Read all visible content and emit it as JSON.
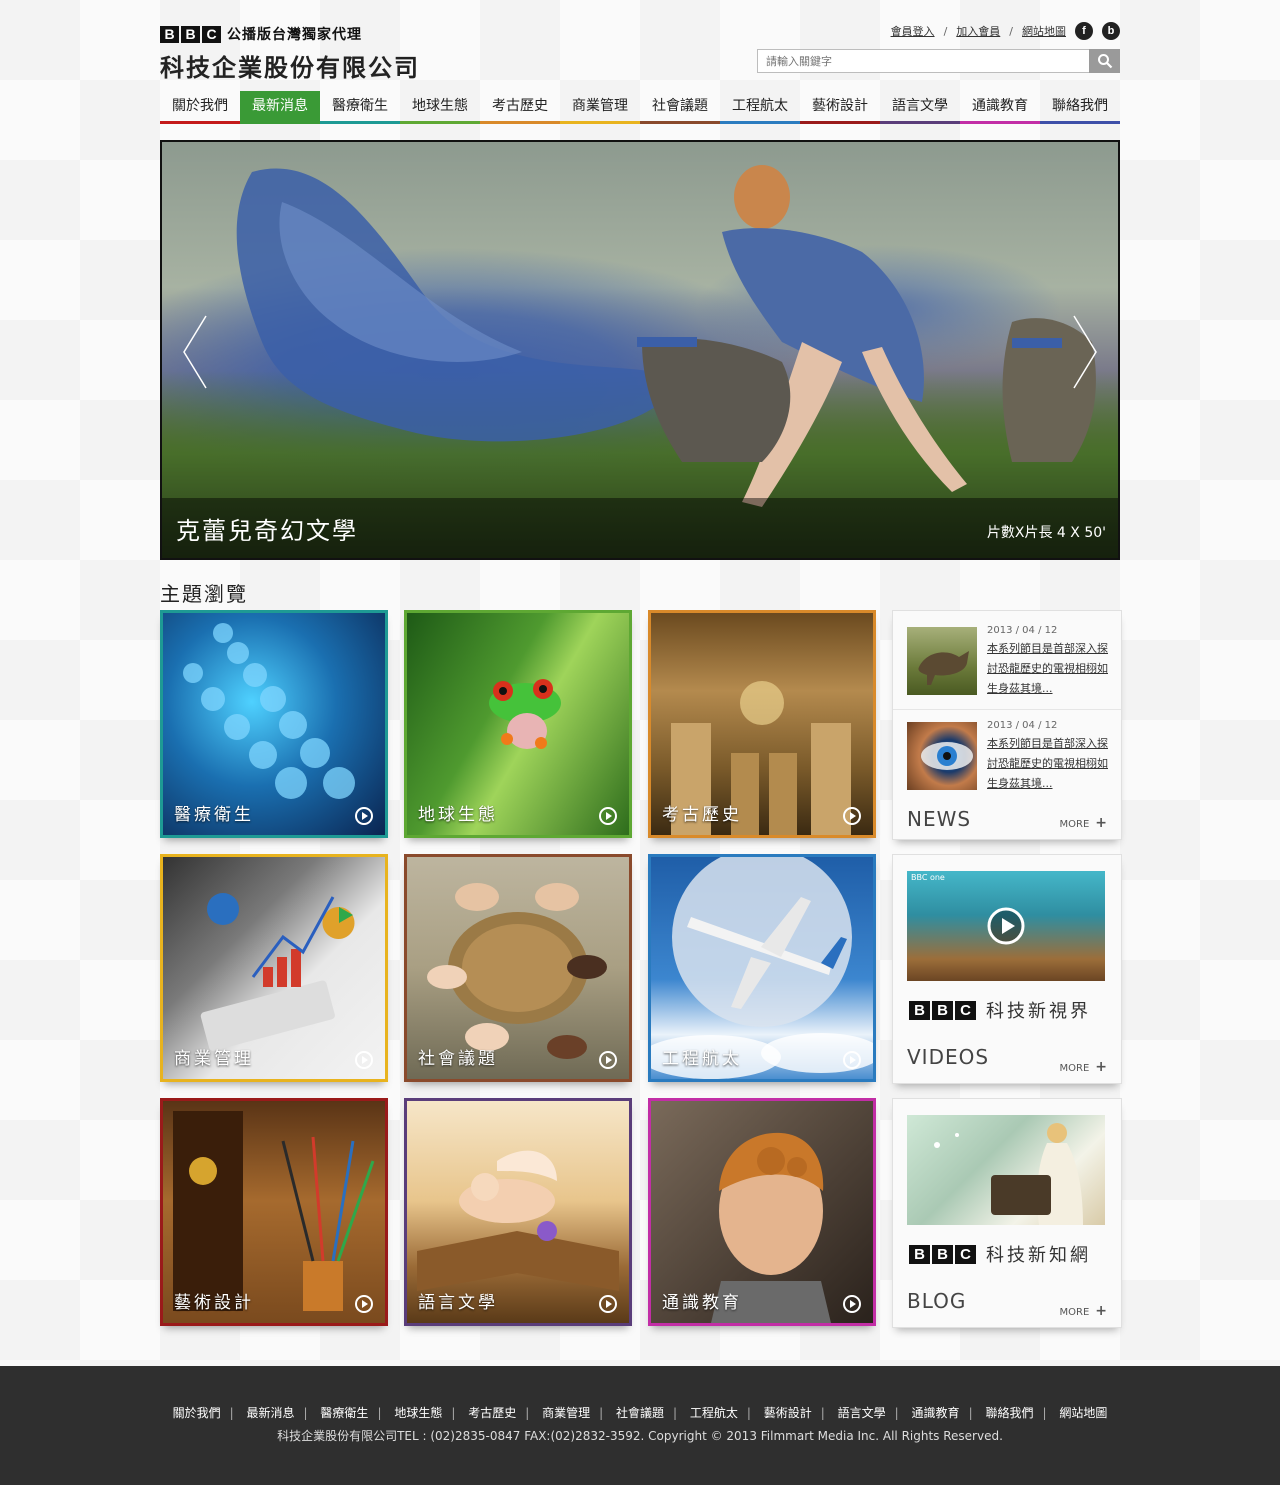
{
  "header": {
    "logo_bbc": [
      "B",
      "B",
      "C"
    ],
    "logo_sub": "公播版台灣獨家代理",
    "logo_main": "科技企業股份有限公司",
    "top_links": [
      "會員登入",
      "加入會員",
      "網站地圖"
    ],
    "social": [
      "facebook-icon",
      "blogger-icon"
    ],
    "search_placeholder": "請輸入關鍵字"
  },
  "nav": {
    "items": [
      {
        "label": "關於我們",
        "color": "#c41a1a"
      },
      {
        "label": "最新消息",
        "color": "#3a9a36"
      },
      {
        "label": "醫療衛生",
        "color": "#1e9a94"
      },
      {
        "label": "地球生態",
        "color": "#5ea833"
      },
      {
        "label": "考古歷史",
        "color": "#d98a2a"
      },
      {
        "label": "商業管理",
        "color": "#e8b31e"
      },
      {
        "label": "社會議題",
        "color": "#8a4a2c"
      },
      {
        "label": "工程航太",
        "color": "#2a7bbf"
      },
      {
        "label": "藝術設計",
        "color": "#9a1a1a"
      },
      {
        "label": "語言文學",
        "color": "#5a3d7a"
      },
      {
        "label": "通識教育",
        "color": "#c22ea6"
      },
      {
        "label": "聯絡我們",
        "color": "#3d4fa8"
      }
    ],
    "active": "最新消息"
  },
  "hero": {
    "title": "克蕾兒奇幻文學",
    "meta": "片數X片長 4 X 50'"
  },
  "section_title": "主題瀏覽",
  "tiles": [
    {
      "label": "醫療衛生",
      "color": "#1e9a94"
    },
    {
      "label": "地球生態",
      "color": "#5ea833"
    },
    {
      "label": "考古歷史",
      "color": "#d98a2a"
    },
    {
      "label": "商業管理",
      "color": "#e8b31e"
    },
    {
      "label": "社會議題",
      "color": "#8a4a2c"
    },
    {
      "label": "工程航太",
      "color": "#2a7bbf"
    },
    {
      "label": "藝術設計",
      "color": "#9a1a1a"
    },
    {
      "label": "語言文學",
      "color": "#5a3d7a"
    },
    {
      "label": "通識教育",
      "color": "#c22ea6"
    }
  ],
  "news": {
    "items": [
      {
        "date": "2013 / 04 / 12",
        "text": "本系列節目是首部深入探討恐龍歷史的電視相栩如生身茲其境..."
      },
      {
        "date": "2013 / 04 / 12",
        "text": "本系列節目是首部深入探討恐龍歷史的電視相栩如生身茲其境..."
      }
    ],
    "heading": "NEWS",
    "more": "MORE"
  },
  "videos": {
    "brand": "科技新視界",
    "heading": "VIDEOS",
    "more": "MORE",
    "thumb_badge": "BBC one"
  },
  "blog": {
    "brand": "科技新知網",
    "heading": "BLOG",
    "more": "MORE"
  },
  "footer": {
    "links": [
      "關於我們",
      "最新消息",
      "醫療衛生",
      "地球生態",
      "考古歷史",
      "商業管理",
      "社會議題",
      "工程航太",
      "藝術設計",
      "語言文學",
      "通識教育",
      "聯絡我們",
      "網站地圖"
    ],
    "copyright": "科技企業股份有限公司TEL : (02)2835-0847   FAX:(02)2832-3592. Copyright © 2013 Filmmart Media Inc. All Rights Reserved."
  }
}
